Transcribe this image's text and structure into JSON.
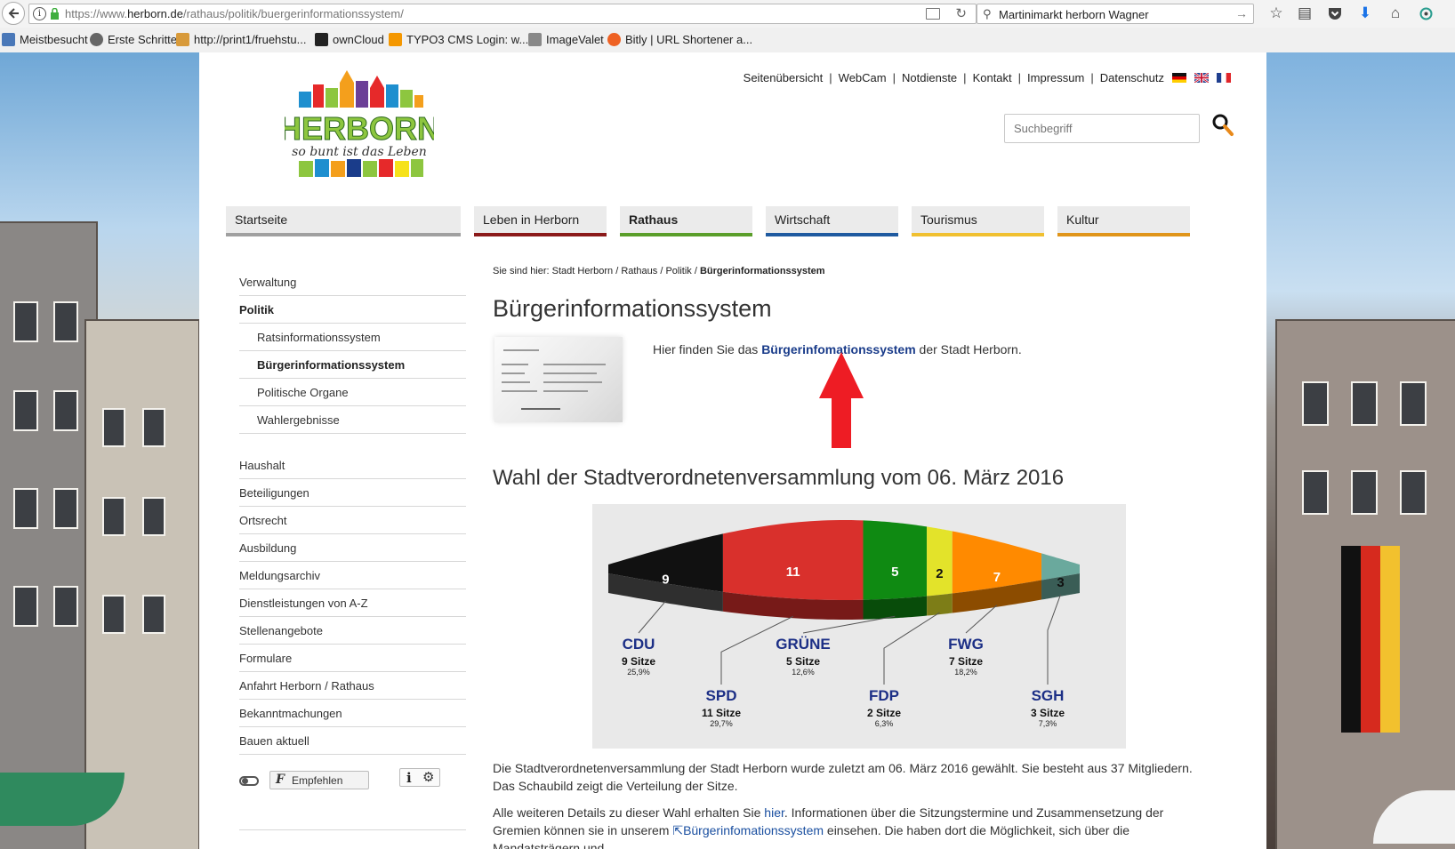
{
  "browser": {
    "url_prefix": "https://www.",
    "url_host": "herborn.de",
    "url_path": "/rathaus/politik/buergerinformationssystem/",
    "search_query": "Martinimarkt herborn Wagner",
    "bookmarks": [
      "Meistbesucht",
      "Erste Schritte",
      "http://print1/fruehstu...",
      "ownCloud",
      "TYPO3 CMS Login: w...",
      "ImageValet",
      "Bitly | URL Shortener a..."
    ]
  },
  "meta_nav": [
    "Seitenübersicht",
    "WebCam",
    "Notdienste",
    "Kontakt",
    "Impressum",
    "Datenschutz"
  ],
  "search": {
    "placeholder": "Suchbegriff"
  },
  "main_nav": [
    {
      "label": "Startseite",
      "color": "#a0a0a0"
    },
    {
      "label": "Leben in Herborn",
      "color": "#8b1a1a"
    },
    {
      "label": "Rathaus",
      "color": "#5a9e2a"
    },
    {
      "label": "Wirtschaft",
      "color": "#1f5aa0"
    },
    {
      "label": "Tourismus",
      "color": "#f0c030"
    },
    {
      "label": "Kultur",
      "color": "#e0951a"
    }
  ],
  "sub_nav": {
    "top": [
      "Verwaltung",
      "Politik"
    ],
    "children": [
      "Ratsinformationssystem",
      "Bürgerinformationssystem",
      "Politische Organe",
      "Wahlergebnisse"
    ],
    "rest": [
      "Haushalt",
      "Beteiligungen",
      "Ortsrecht",
      "Ausbildung",
      "Meldungsarchiv",
      "Dienstleistungen von A-Z",
      "Stellenangebote",
      "Formulare",
      "Anfahrt Herborn / Rathaus",
      "Bekanntmachungen",
      "Bauen aktuell"
    ]
  },
  "tools": {
    "empfehlen": "Empfehlen"
  },
  "breadcrumb": {
    "prefix": "Sie sind hier:",
    "items": [
      "Stadt Herborn",
      "Rathaus",
      "Politik"
    ],
    "current": "Bürgerinformationssystem"
  },
  "title": "Bürgerinformationssystem",
  "intro": {
    "before": "Hier finden Sie das ",
    "link": "Bürgerinfomationssystem",
    "after": " der Stadt Herborn."
  },
  "election_heading": "Wahl der Stadtverordnetenversammlung vom 06. März 2016",
  "chart_data": {
    "type": "pie",
    "series": [
      {
        "name": "CDU",
        "seats": 9,
        "seats_label": "9 Sitze",
        "percent": "25,9%",
        "color": "#111111"
      },
      {
        "name": "SPD",
        "seats": 11,
        "seats_label": "11 Sitze",
        "percent": "29,7%",
        "color": "#d9302c"
      },
      {
        "name": "GRÜNE",
        "seats": 5,
        "seats_label": "5 Sitze",
        "percent": "12,6%",
        "color": "#0f8a12"
      },
      {
        "name": "FDP",
        "seats": 2,
        "seats_label": "2 Sitze",
        "percent": "6,3%",
        "color": "#e3e32a"
      },
      {
        "name": "FWG",
        "seats": 7,
        "seats_label": "7 Sitze",
        "percent": "18,2%",
        "color": "#ff8a00"
      },
      {
        "name": "SGH",
        "seats": 3,
        "seats_label": "3 Sitze",
        "percent": "7,3%",
        "color": "#6aa99d"
      }
    ]
  },
  "para1": "Die Stadtverordnetenversammlung der Stadt Herborn wurde zuletzt am 06. März 2016 gewählt. Sie besteht aus 37 Mitgliedern. Das Schaubild zeigt die Verteilung der Sitze.",
  "para2": {
    "a": "Alle weiteren Details zu dieser Wahl erhalten Sie ",
    "link1": "hier",
    "b": ". Informationen über die Sitzungstermine und Zusammensetzung der Gremien können sie in unserem ",
    "link2": "Bürgerinfomationssystem",
    "c": " einsehen. Die haben dort die Möglichkeit, sich über die Mandatsträgern und"
  }
}
